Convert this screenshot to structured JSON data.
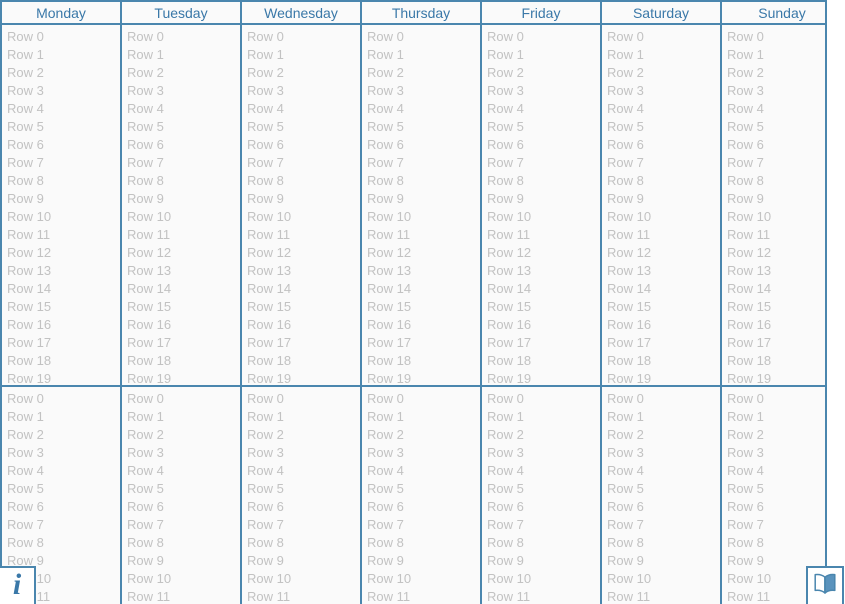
{
  "table": {
    "columns": [
      "Monday",
      "Tuesday",
      "Wednesday",
      "Thursday",
      "Friday",
      "Saturday",
      "Sunday"
    ],
    "row_label_prefix": "Row",
    "first_section_rows": [
      "Row 0",
      "Row 1",
      "Row 2",
      "Row 3",
      "Row 4",
      "Row 5",
      "Row 6",
      "Row 7",
      "Row 8",
      "Row 9",
      "Row 10",
      "Row 11",
      "Row 12",
      "Row 13",
      "Row 14",
      "Row 15",
      "Row 16",
      "Row 17",
      "Row 18",
      "Row 19"
    ],
    "second_section_rows": [
      "Row 0",
      "Row 1",
      "Row 2",
      "Row 3",
      "Row 4",
      "Row 5",
      "Row 6",
      "Row 7",
      "Row 8",
      "Row 9",
      "Row 10",
      "Row 11"
    ]
  },
  "widgets": {
    "info_icon": "info-icon",
    "info_glyph": "i",
    "book_icon": "open-book-icon"
  },
  "colors": {
    "border": "#4a86ae",
    "header_text": "#3a78a8",
    "cell_text": "#c2c2c2",
    "surface": "#fafafa",
    "page": "#ffffff"
  }
}
